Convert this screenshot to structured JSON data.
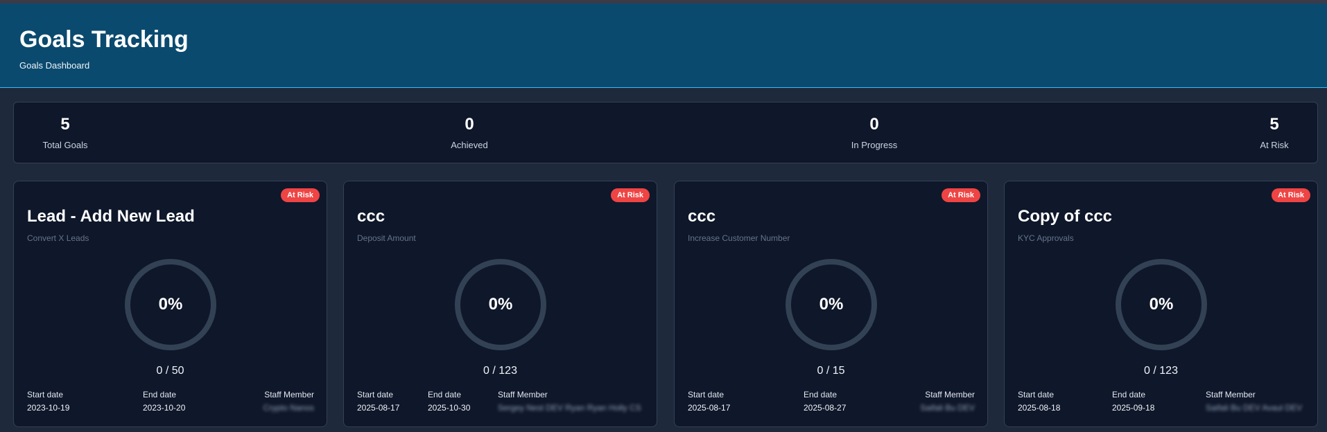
{
  "header": {
    "title": "Goals Tracking",
    "subtitle": "Goals Dashboard"
  },
  "summary": [
    {
      "value": "5",
      "label": "Total Goals"
    },
    {
      "value": "0",
      "label": "Achieved"
    },
    {
      "value": "0",
      "label": "In Progress"
    },
    {
      "value": "5",
      "label": "At Risk"
    }
  ],
  "labels": {
    "start": "Start date",
    "end": "End date",
    "staff": "Staff Member"
  },
  "cards": [
    {
      "status": "At Risk",
      "title": "Lead - Add New Lead",
      "subtitle": "Convert X Leads",
      "progress": 0,
      "percent_text": "0%",
      "count": "0 / 50",
      "start_date": "2023-10-19",
      "end_date": "2023-10-20",
      "staff": "Crypto Nanos"
    },
    {
      "status": "At Risk",
      "title": "ccc",
      "subtitle": "Deposit Amount",
      "progress": 0,
      "percent_text": "0%",
      "count": "0 / 123",
      "start_date": "2025-08-17",
      "end_date": "2025-10-30",
      "staff": "Sergey Nest DEV Ryan Ryan Holly CS"
    },
    {
      "status": "At Risk",
      "title": "ccc",
      "subtitle": "Increase Customer Number",
      "progress": 0,
      "percent_text": "0%",
      "count": "0 / 15",
      "start_date": "2025-08-17",
      "end_date": "2025-08-27",
      "staff": "Saifali Bu DEV"
    },
    {
      "status": "At Risk",
      "title": "Copy of ccc",
      "subtitle": "KYC Approvals",
      "progress": 0,
      "percent_text": "0%",
      "count": "0 / 123",
      "start_date": "2025-08-18",
      "end_date": "2025-09-18",
      "staff": "Saifali Bu DEV Avaul DEV"
    }
  ],
  "colors": {
    "header_bg": "#0b4a6f",
    "page_bg": "#1e293b",
    "card_bg": "#0f172a",
    "ring_track": "#334155",
    "badge_bg": "#ef4444"
  }
}
